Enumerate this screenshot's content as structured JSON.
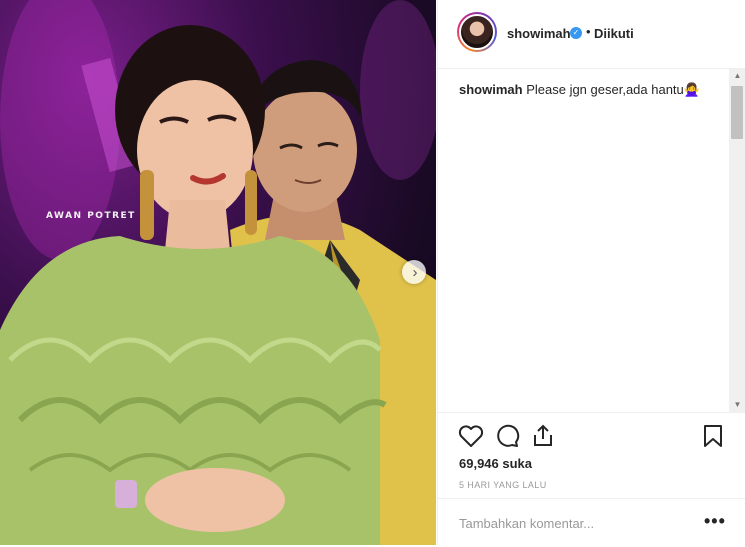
{
  "photo": {
    "watermark": "AWAN POTRET",
    "next_icon": "chevron-right-icon",
    "colors": {
      "background": "#3b0f4d",
      "dress": "#a8c26a",
      "jacket": "#e0c24a"
    }
  },
  "header": {
    "username": "showimah",
    "verified_icon": "verified-badge-icon",
    "separator": "•",
    "follow_status": "Diikuti"
  },
  "caption": {
    "username": "showimah",
    "text": "Please jgn geser,ada hantu🙅‍♀️"
  },
  "actions": {
    "like_icon": "heart-icon",
    "comment_icon": "comment-bubble-icon",
    "share_icon": "share-icon",
    "save_icon": "bookmark-icon",
    "likes": "69,946 suka",
    "timestamp": "5 HARI YANG LALU"
  },
  "comment_box": {
    "placeholder": "Tambahkan komentar...",
    "more_label": "•••"
  },
  "colors": {
    "accent": "#3897f0",
    "border": "#efefef",
    "muted": "#999999"
  }
}
